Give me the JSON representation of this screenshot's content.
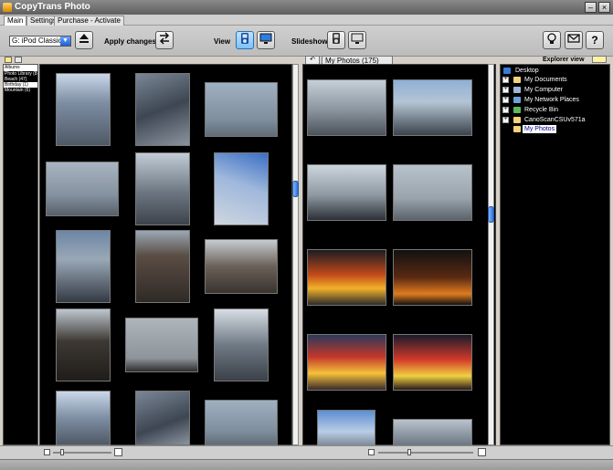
{
  "window": {
    "title": "CopyTrans Photo"
  },
  "tabs": [
    {
      "label": "Main",
      "active": true
    },
    {
      "label": "Settings",
      "active": false
    },
    {
      "label": "Purchase - Activate",
      "active": false
    }
  ],
  "toolbar": {
    "device": "G: iPod Classic",
    "apply_label": "Apply changes",
    "view_label": "View",
    "slideshow_label": "Slideshow"
  },
  "albums": {
    "header": "Albums",
    "items": [
      {
        "label": "Photo Library (88)",
        "selected": false
      },
      {
        "label": "Beach (47)",
        "selected": false
      },
      {
        "label": "Birthday (1)",
        "selected": true
      },
      {
        "label": "Mountain (6)",
        "selected": false
      }
    ]
  },
  "pc_panel": {
    "folder_label": "My Photos (175)"
  },
  "explorer": {
    "label": "Explorer view",
    "tree": [
      {
        "label": "Desktop",
        "expander": false,
        "icon": "desktop-icon",
        "indent": 0,
        "selected": false
      },
      {
        "label": "My Documents",
        "expander": true,
        "icon": "folder-icon",
        "indent": 1,
        "selected": false
      },
      {
        "label": "My Computer",
        "expander": true,
        "icon": "computer-icon",
        "indent": 1,
        "selected": false
      },
      {
        "label": "My Network Places",
        "expander": true,
        "icon": "network-icon",
        "indent": 1,
        "selected": false
      },
      {
        "label": "Recycle Bin",
        "expander": true,
        "icon": "recycle-bin-icon",
        "indent": 1,
        "selected": false
      },
      {
        "label": "CanoScanCSUv571a",
        "expander": true,
        "icon": "folder-icon",
        "indent": 1,
        "selected": false
      },
      {
        "label": "My Photos",
        "expander": false,
        "icon": "folder-icon",
        "indent": 1,
        "selected": true
      }
    ]
  },
  "colors": {
    "accent": "#2f6fd8",
    "pane_bg": "#000000",
    "selection": "#ffffff"
  }
}
